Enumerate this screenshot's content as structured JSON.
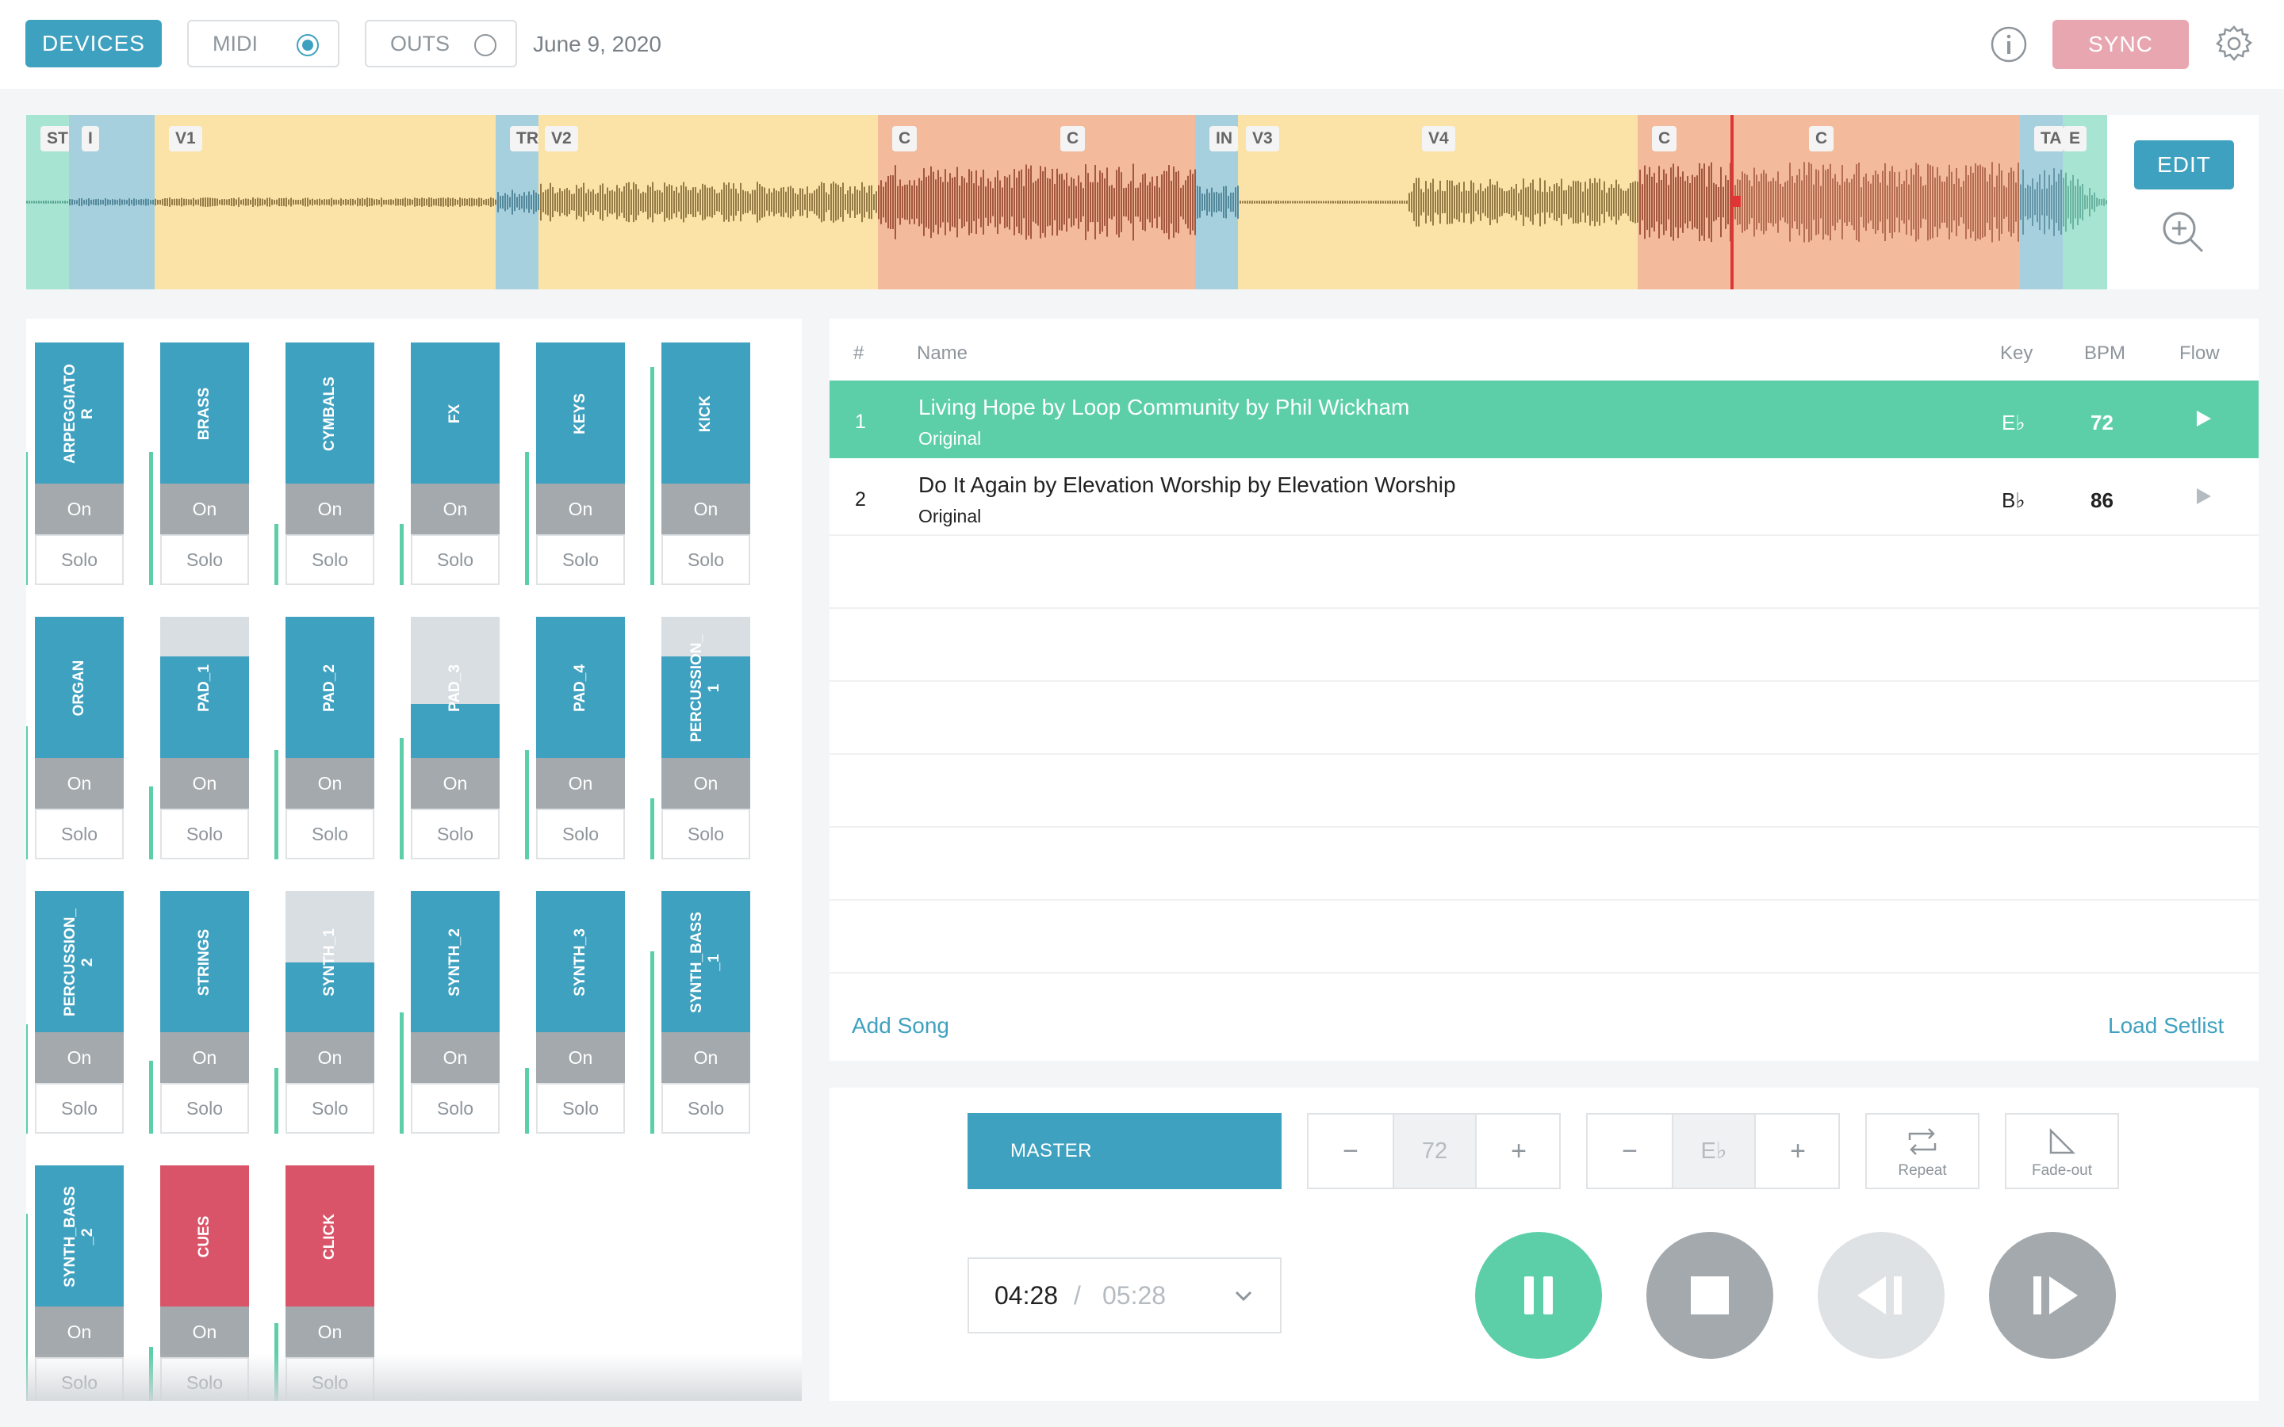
{
  "topbar": {
    "devices_label": "DEVICES",
    "midi_label": "MIDI",
    "outs_label": "OUTS",
    "date": "June 9, 2020",
    "sync_label": "SYNC"
  },
  "arrangement": {
    "edit_label": "EDIT",
    "segments": [
      {
        "label": "ST",
        "color": "#a8e4d2"
      },
      {
        "label": "I",
        "color": "#a6d0de"
      },
      {
        "label": "V1",
        "color": "#fbe3a8"
      },
      {
        "label": "TR",
        "color": "#a6d0de"
      },
      {
        "label": "V2",
        "color": "#fbe3a8"
      },
      {
        "label": "C",
        "color": "#f3bb9b"
      },
      {
        "label": "C",
        "color": "#f3bb9b"
      },
      {
        "label": "IN",
        "color": "#a6d0de"
      },
      {
        "label": "V3",
        "color": "#fbe3a8"
      },
      {
        "label": "V4",
        "color": "#fbe3a8"
      },
      {
        "label": "C",
        "color": "#f3bb9b"
      },
      {
        "label": "C",
        "color": "#f3bb9b"
      },
      {
        "label": "TA",
        "color": "#a6d0de"
      },
      {
        "label": "E",
        "color": "#a8e4d2"
      }
    ]
  },
  "tracks": {
    "on_label": "On",
    "solo_label": "Solo",
    "items": [
      {
        "name": "ARPEGGIATO\nR",
        "red": false,
        "level": 0.55
      },
      {
        "name": "BRASS",
        "red": false,
        "level": 0.55
      },
      {
        "name": "CYMBALS",
        "red": false,
        "level": 0.25
      },
      {
        "name": "FX",
        "red": false,
        "level": 0.25
      },
      {
        "name": "KEYS",
        "red": false,
        "level": 0.55
      },
      {
        "name": "KICK",
        "red": false,
        "level": 0.9
      },
      {
        "name": "ORGAN",
        "red": false,
        "level": 0.55
      },
      {
        "name": "PAD_1",
        "red": false,
        "level": 0.3
      },
      {
        "name": "PAD_2",
        "red": false,
        "level": 0.45
      },
      {
        "name": "PAD_3",
        "red": false,
        "level": 0.5
      },
      {
        "name": "PAD_4",
        "red": false,
        "level": 0.45
      },
      {
        "name": "PERCUSSION_\n1",
        "red": false,
        "level": 0.25
      },
      {
        "name": "PERCUSSION_\n2",
        "red": false,
        "level": 0.45
      },
      {
        "name": "STRINGS",
        "red": false,
        "level": 0.3
      },
      {
        "name": "SYNTH_1",
        "red": false,
        "level": 0.27
      },
      {
        "name": "SYNTH_2",
        "red": false,
        "level": 0.5
      },
      {
        "name": "SYNTH_3",
        "red": false,
        "level": 0.27
      },
      {
        "name": "SYNTH_BASS\n_1",
        "red": false,
        "level": 0.75
      },
      {
        "name": "SYNTH_BASS\n_2",
        "red": false,
        "level": 0.8
      },
      {
        "name": "CUES",
        "red": true,
        "level": 0.25
      },
      {
        "name": "CLICK",
        "red": true,
        "level": 0.35
      }
    ]
  },
  "setlist": {
    "col_num": "#",
    "col_name": "Name",
    "col_key": "Key",
    "col_bpm": "BPM",
    "col_flow": "Flow",
    "songs": [
      {
        "num": "1",
        "title": "Living Hope by Loop Community by Phil Wickham",
        "arrangement": "Original",
        "key": "E♭",
        "bpm": "72"
      },
      {
        "num": "2",
        "title": "Do It Again by Elevation Worship by Elevation Worship",
        "arrangement": "Original",
        "key": "B♭",
        "bpm": "86"
      }
    ],
    "add_song_label": "Add Song",
    "load_setlist_label": "Load Setlist"
  },
  "transport": {
    "master_label": "MASTER",
    "bpm_value": "72",
    "key_value": "E♭",
    "minus": "−",
    "plus": "+",
    "repeat_label": "Repeat",
    "fadeout_label": "Fade-out",
    "current_time": "04:28",
    "time_sep": "/",
    "total_time": "05:28",
    "playback_progress": 0.829
  },
  "colors": {
    "accent_blue": "#3fa1c0",
    "accent_green": "#5ccfa9",
    "sync_pink": "#e8a7b0",
    "track_red": "#d95468",
    "button_gray": "#a3a9ad"
  }
}
